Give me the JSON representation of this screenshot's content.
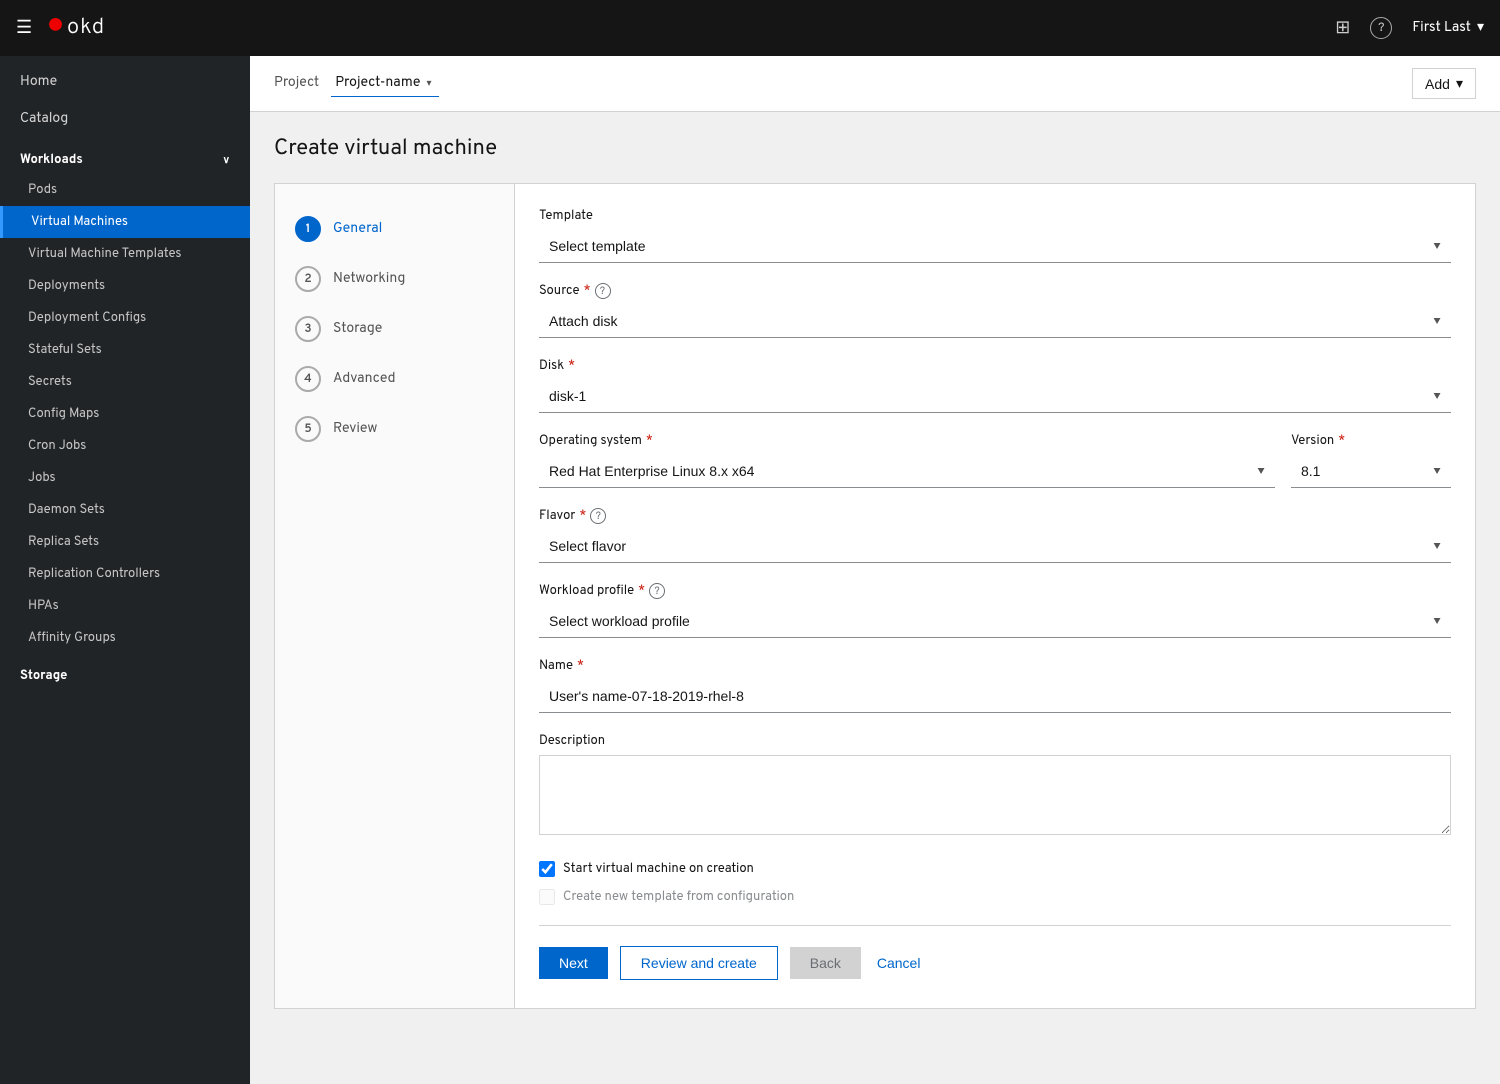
{
  "topnav": {
    "logo_icon": "●",
    "logo_text": "okd",
    "user_label": "First Last",
    "grid_icon": "⊞",
    "help_icon": "?",
    "chevron_down": "▾"
  },
  "header": {
    "project_label": "Project",
    "project_name": "Project-name",
    "add_label": "Add"
  },
  "page": {
    "title": "Create virtual machine"
  },
  "sidebar": {
    "home_label": "Home",
    "catalog_label": "Catalog",
    "workloads_label": "Workloads",
    "workloads_chevron": "∨",
    "items": [
      {
        "id": "pods",
        "label": "Pods"
      },
      {
        "id": "virtual-machines",
        "label": "Virtual Machines",
        "active": true
      },
      {
        "id": "virtual-machine-templates",
        "label": "Virtual Machine Templates"
      },
      {
        "id": "deployments",
        "label": "Deployments"
      },
      {
        "id": "deployment-configs",
        "label": "Deployment Configs"
      },
      {
        "id": "stateful-sets",
        "label": "Stateful Sets"
      },
      {
        "id": "secrets",
        "label": "Secrets"
      },
      {
        "id": "config-maps",
        "label": "Config Maps"
      },
      {
        "id": "cron-jobs",
        "label": "Cron Jobs"
      },
      {
        "id": "jobs",
        "label": "Jobs"
      },
      {
        "id": "daemon-sets",
        "label": "Daemon Sets"
      },
      {
        "id": "replica-sets",
        "label": "Replica Sets"
      },
      {
        "id": "replication-controllers",
        "label": "Replication Controllers"
      },
      {
        "id": "hpas",
        "label": "HPAs"
      },
      {
        "id": "affinity-groups",
        "label": "Affinity Groups"
      }
    ],
    "storage_label": "Storage"
  },
  "wizard": {
    "steps": [
      {
        "number": "1",
        "label": "General",
        "active": true
      },
      {
        "number": "2",
        "label": "Networking"
      },
      {
        "number": "3",
        "label": "Storage"
      },
      {
        "number": "4",
        "label": "Advanced"
      },
      {
        "number": "5",
        "label": "Review"
      }
    ],
    "form": {
      "template_label": "Template",
      "template_placeholder": "Select template",
      "source_label": "Source",
      "source_required": "*",
      "source_value": "Attach disk",
      "disk_label": "Disk",
      "disk_required": "*",
      "disk_value": "disk-1",
      "os_label": "Operating system",
      "os_required": "*",
      "os_value": "Red Hat Enterprise Linux 8.x x64",
      "version_label": "Version",
      "version_required": "*",
      "version_value": "8.1",
      "flavor_label": "Flavor",
      "flavor_required": "*",
      "flavor_placeholder": "Select flavor",
      "workload_label": "Workload profile",
      "workload_required": "*",
      "workload_placeholder": "Select workload profile",
      "name_label": "Name",
      "name_required": "*",
      "name_value": "User's name-07-18-2019-rhel-8",
      "description_label": "Description",
      "checkbox1_label": "Start virtual machine on creation",
      "checkbox2_label": "Create new template from configuration"
    },
    "footer": {
      "next_label": "Next",
      "review_label": "Review and create",
      "back_label": "Back",
      "cancel_label": "Cancel"
    }
  }
}
